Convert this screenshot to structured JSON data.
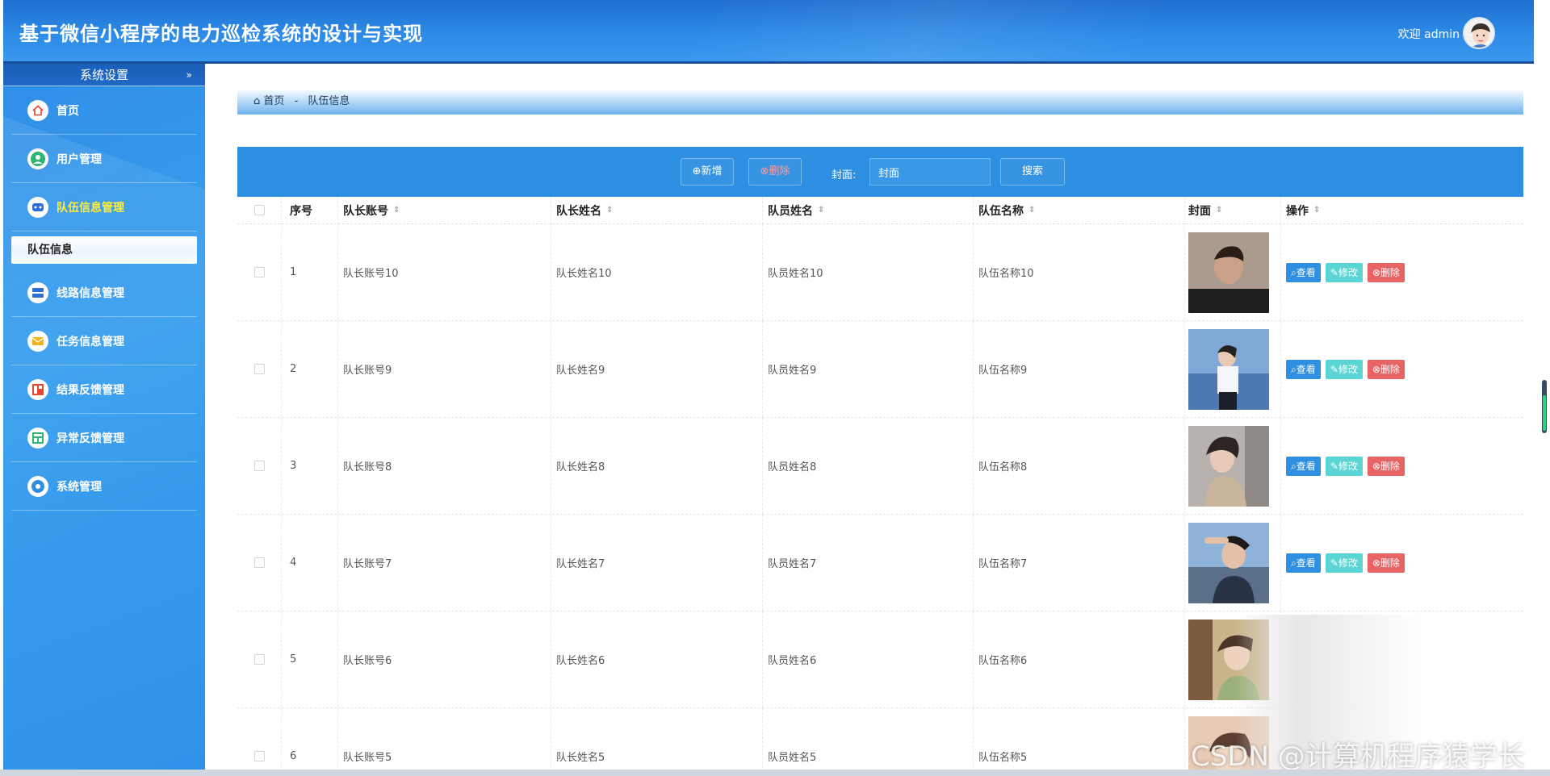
{
  "header": {
    "title": "基于微信小程序的电力巡检系统的设计与实现",
    "welcome": "欢迎 admin"
  },
  "sidebar": {
    "section_title": "系统设置",
    "items": [
      {
        "label": "首页",
        "icon": "home-icon",
        "color": "#e8462e"
      },
      {
        "label": "用户管理",
        "icon": "user-icon",
        "color": "#2bb673"
      },
      {
        "label": "队伍信息管理",
        "icon": "team-icon",
        "color": "#2e6fd6",
        "active": true
      },
      {
        "label": "线路信息管理",
        "icon": "server-icon",
        "color": "#2e6fd6"
      },
      {
        "label": "任务信息管理",
        "icon": "mail-icon",
        "color": "#f2b21c"
      },
      {
        "label": "结果反馈管理",
        "icon": "dashboard-icon",
        "color": "#e8462e"
      },
      {
        "label": "异常反馈管理",
        "icon": "grid-icon",
        "color": "#2bb673"
      },
      {
        "label": "系统管理",
        "icon": "settings-icon",
        "color": "#2e8fe0"
      }
    ],
    "sub_item": "队伍信息"
  },
  "breadcrumb": {
    "home": "首页",
    "separator": "-",
    "current": "队伍信息"
  },
  "toolbar": {
    "add_label": "新增",
    "delete_label": "删除",
    "filter_label": "封面:",
    "filter_value": "封面",
    "search_label": "搜索"
  },
  "table": {
    "columns": [
      "序号",
      "队长账号",
      "队长姓名",
      "队员姓名",
      "队伍名称",
      "封面",
      "操作"
    ],
    "rows": [
      {
        "no": "1",
        "captain_account": "队长账号10",
        "captain_name": "队长姓名10",
        "member_name": "队员姓名10",
        "team_name": "队伍名称10"
      },
      {
        "no": "2",
        "captain_account": "队长账号9",
        "captain_name": "队长姓名9",
        "member_name": "队员姓名9",
        "team_name": "队伍名称9"
      },
      {
        "no": "3",
        "captain_account": "队长账号8",
        "captain_name": "队长姓名8",
        "member_name": "队员姓名8",
        "team_name": "队伍名称8"
      },
      {
        "no": "4",
        "captain_account": "队长账号7",
        "captain_name": "队长姓名7",
        "member_name": "队员姓名7",
        "team_name": "队伍名称7"
      },
      {
        "no": "5",
        "captain_account": "队长账号6",
        "captain_name": "队长姓名6",
        "member_name": "队员姓名6",
        "team_name": "队伍名称6"
      },
      {
        "no": "6",
        "captain_account": "队长账号5",
        "captain_name": "队长姓名5",
        "member_name": "队员姓名5",
        "team_name": "队伍名称5"
      }
    ],
    "actions": {
      "view": "查看",
      "edit": "修改",
      "delete": "删除"
    }
  },
  "watermark": "CSDN @计算机程序猿学长"
}
